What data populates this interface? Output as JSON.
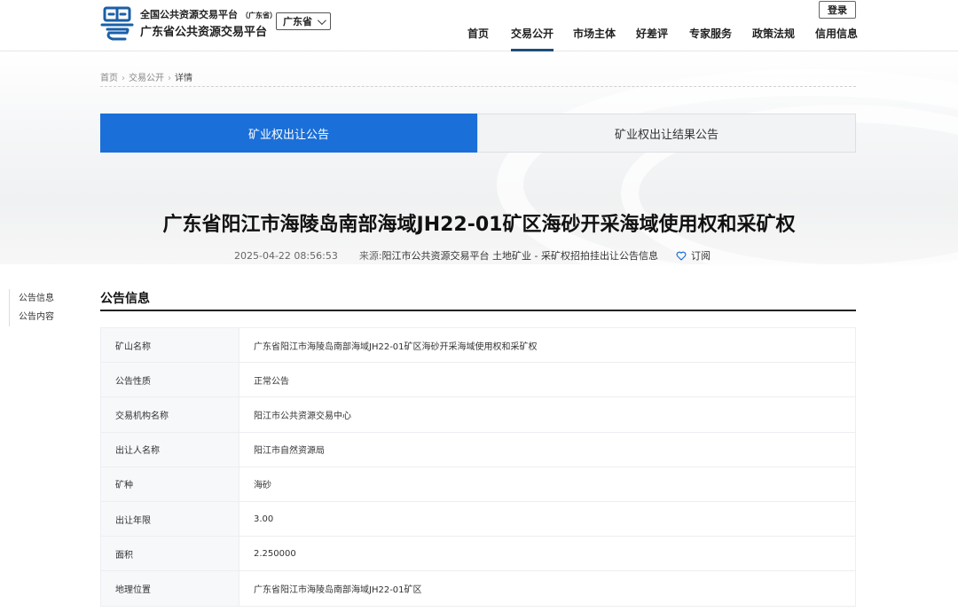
{
  "header": {
    "logo_line1": "全国公共资源交易平台",
    "logo_line1_suffix": "（广东省）",
    "logo_line2": "广东省公共资源交易平台",
    "region": "广东省",
    "login": "登录",
    "nav": [
      "首页",
      "交易公开",
      "市场主体",
      "好差评",
      "专家服务",
      "政策法规",
      "信用信息"
    ],
    "active_nav": "交易公开"
  },
  "breadcrumb": [
    "首页",
    "交易公开",
    "详情"
  ],
  "tabs": [
    "矿业权出让公告",
    "矿业权出让结果公告"
  ],
  "article": {
    "title": "广东省阳江市海陵岛南部海域JH22-01矿区海砂开采海域使用权和采矿权",
    "date": "2025-04-22 08:56:53",
    "source_label": "来源:",
    "source": "阳江市公共资源交易平台 土地矿业 - 采矿权招拍挂出让公告信息",
    "subscribe": "订阅"
  },
  "sidenav": [
    "公告信息",
    "公告内容"
  ],
  "section": {
    "title": "公告信息",
    "rows": [
      {
        "k": "矿山名称",
        "v": "广东省阳江市海陵岛南部海域JH22-01矿区海砂开采海域使用权和采矿权"
      },
      {
        "k": "公告性质",
        "v": "正常公告"
      },
      {
        "k": "交易机构名称",
        "v": "阳江市公共资源交易中心"
      },
      {
        "k": "出让人名称",
        "v": "阳江市自然资源局"
      },
      {
        "k": "矿种",
        "v": "海砂"
      },
      {
        "k": "出让年限",
        "v": "3.00"
      },
      {
        "k": "面积",
        "v": "2.250000"
      },
      {
        "k": "地理位置",
        "v": "广东省阳江市海陵岛南部海域JH22-01矿区"
      }
    ]
  },
  "colors": {
    "accent": "#1b6fd8",
    "logo": "#1a5fa8",
    "nav_underline": "#1f4e79"
  },
  "icons": {
    "logo": "yue-logo-icon",
    "region_chevron": "chevron-down-icon",
    "subscribe": "heart-icon"
  }
}
